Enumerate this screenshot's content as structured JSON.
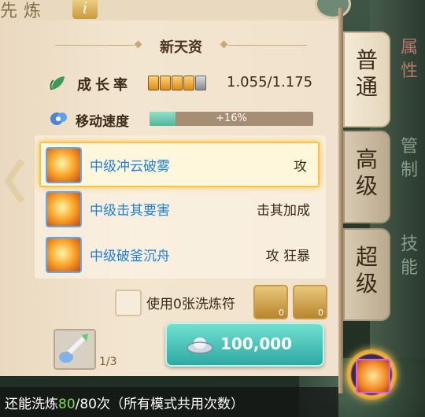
{
  "top": {
    "title": "先炼",
    "info_icon": "info-icon"
  },
  "section": {
    "title": "新天资"
  },
  "growth": {
    "label": "成长率",
    "value": "1.055/1.175",
    "pips_filled": 4,
    "pips_total": 5
  },
  "speed": {
    "label": "移动速度",
    "bar_text": "+16%",
    "fill_fraction": 0.16
  },
  "skills": [
    {
      "name": "中级冲云破雾",
      "tag": "攻",
      "selected": true
    },
    {
      "name": "中级击其要害",
      "tag": "击其加成",
      "selected": false
    },
    {
      "name": "中级破釜沉舟",
      "tag": "攻 狂暴",
      "selected": false
    }
  ],
  "use_charm": {
    "label": "使用0张洗炼符",
    "charms": [
      {
        "count": "0"
      },
      {
        "count": "0"
      }
    ]
  },
  "item": {
    "count": "1/3"
  },
  "cost": {
    "amount": "100,000",
    "icon": "silver-ingot-icon"
  },
  "remain": {
    "prefix": "还能洗炼",
    "used": "80",
    "suffix": "/80次（所有模式共用次数）"
  },
  "tabs": [
    {
      "label": "普通",
      "active": true
    },
    {
      "label": "高级",
      "active": false
    },
    {
      "label": "超级",
      "active": false
    }
  ],
  "side_tabs": [
    "属性",
    "管制",
    "技能"
  ],
  "colors": {
    "accent_blue": "#1e7fd9",
    "button_teal": "#2ea9a3",
    "highlight_gold": "#f7c34a",
    "remain_green": "#7be34a"
  }
}
